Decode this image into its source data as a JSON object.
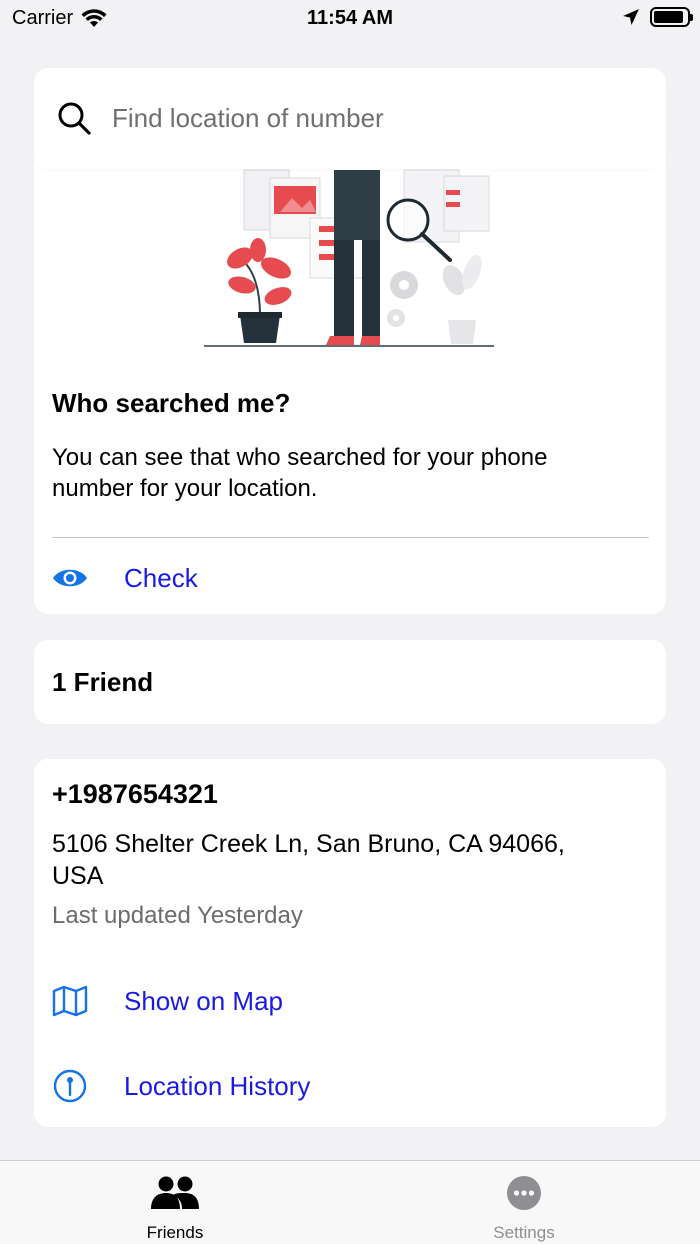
{
  "status_bar": {
    "carrier": "Carrier",
    "time": "11:54 AM",
    "icons": [
      "wifi-icon",
      "location-arrow-icon",
      "battery-icon"
    ],
    "battery_level": 0.9
  },
  "search": {
    "placeholder": "Find location of number",
    "value": "",
    "icon": "search-icon"
  },
  "who_searched": {
    "illustration": "person-searching-illustration",
    "title": "Who searched me?",
    "description": "You can see that who searched for your phone number for your location.",
    "action": {
      "label": "Check",
      "icon": "eye-icon"
    }
  },
  "friends": {
    "count_label": "1 Friend"
  },
  "friend": {
    "phone": "+1987654321",
    "address": "5106 Shelter Creek Ln, San Bruno, CA 94066, USA",
    "last_updated": "Last updated Yesterday",
    "actions": [
      {
        "label": "Show on Map",
        "icon": "map-icon"
      },
      {
        "label": "Location History",
        "icon": "pin-history-icon"
      }
    ]
  },
  "tab_bar": {
    "tabs": [
      {
        "label": "Friends",
        "icon": "people-icon",
        "active": true
      },
      {
        "label": "Settings",
        "icon": "more-icon",
        "active": false
      }
    ]
  },
  "colors": {
    "link": "#1a1be0",
    "accent_icon": "#1473e6",
    "background": "#f2f2f4",
    "card": "#ffffff"
  }
}
